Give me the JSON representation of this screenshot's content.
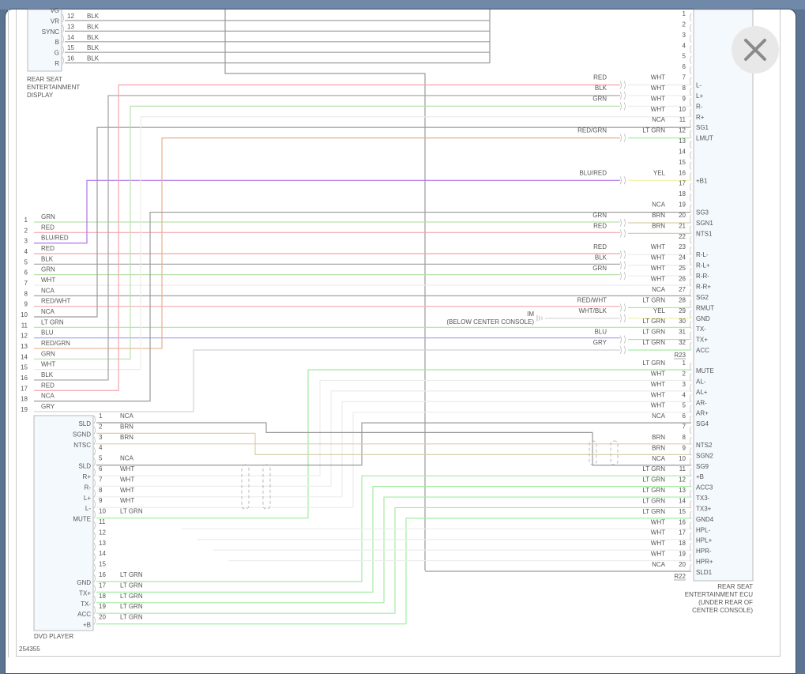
{
  "viewer": {
    "close_icon": "close-icon",
    "figure_id": "254355"
  },
  "wire_colors": {
    "RED": "#f4a3ad",
    "GRN": "#b9e0ac",
    "BLK": "#a0a0a0",
    "WHT": "#ececec",
    "NCA": "#9a9a9a",
    "LT GRN": "#a3eca3",
    "BRN": "#dccdb0",
    "YEL": "#f3f0a6",
    "BLU": "#a8a8f4",
    "RED/GRN": "#e6b08a",
    "BLU/RED": "#b273e8",
    "GRY": "#d2d2d2",
    "RED/WHT": "#f3b6b6",
    "WHT/BLK": "#d8d8d8"
  },
  "display": {
    "name_lines": [
      "REAR SEAT",
      "ENTERTAINMENT",
      "DISPLAY"
    ],
    "labels": [
      "VG",
      "VR",
      "SYNC",
      "B",
      "G",
      "R"
    ],
    "rows": [
      {
        "pin": "12",
        "color": "BLK"
      },
      {
        "pin": "13",
        "color": "BLK"
      },
      {
        "pin": "14",
        "color": "BLK"
      },
      {
        "pin": "15",
        "color": "BLK"
      },
      {
        "pin": "16",
        "color": "BLK"
      }
    ]
  },
  "left_connector": {
    "rows": [
      {
        "pin": "1",
        "color": "GRN"
      },
      {
        "pin": "2",
        "color": "RED"
      },
      {
        "pin": "3",
        "color": "BLU/RED"
      },
      {
        "pin": "4",
        "color": "RED"
      },
      {
        "pin": "5",
        "color": "BLK"
      },
      {
        "pin": "6",
        "color": "GRN"
      },
      {
        "pin": "7",
        "color": "WHT"
      },
      {
        "pin": "8",
        "color": "NCA"
      },
      {
        "pin": "9",
        "color": "RED/WHT"
      },
      {
        "pin": "10",
        "color": "NCA"
      },
      {
        "pin": "11",
        "color": "LT GRN"
      },
      {
        "pin": "12",
        "color": "BLU"
      },
      {
        "pin": "13",
        "color": "RED/GRN"
      },
      {
        "pin": "14",
        "color": "GRN"
      },
      {
        "pin": "15",
        "color": "WHT"
      },
      {
        "pin": "16",
        "color": "BLK"
      },
      {
        "pin": "17",
        "color": "RED"
      },
      {
        "pin": "18",
        "color": "NCA"
      },
      {
        "pin": "19",
        "color": "GRY"
      }
    ]
  },
  "ecu": {
    "name_lines": [
      "REAR SEAT",
      "ENTERTAINMENT ECU",
      "(UNDER REAR OF",
      "CENTER CONSOLE)"
    ],
    "r23": {
      "id": "R23",
      "rows": [
        {
          "pin": "1",
          "left": "",
          "right": "",
          "func": ""
        },
        {
          "pin": "2",
          "left": "",
          "right": "",
          "func": ""
        },
        {
          "pin": "3",
          "left": "",
          "right": "",
          "func": ""
        },
        {
          "pin": "4",
          "left": "",
          "right": "",
          "func": ""
        },
        {
          "pin": "5",
          "left": "",
          "right": "",
          "func": ""
        },
        {
          "pin": "6",
          "left": "",
          "right": "",
          "func": ""
        },
        {
          "pin": "7",
          "left": "RED",
          "right": "WHT",
          "func": "L-"
        },
        {
          "pin": "8",
          "left": "BLK",
          "right": "WHT",
          "func": "L+"
        },
        {
          "pin": "9",
          "left": "GRN",
          "right": "WHT",
          "func": "R-"
        },
        {
          "pin": "10",
          "left": "",
          "right": "WHT",
          "func": "R+"
        },
        {
          "pin": "11",
          "left": "",
          "right": "NCA",
          "func": "SG1"
        },
        {
          "pin": "12",
          "left": "RED/GRN",
          "right": "LT GRN",
          "func": "LMUT"
        },
        {
          "pin": "13",
          "left": "",
          "right": "",
          "func": ""
        },
        {
          "pin": "14",
          "left": "",
          "right": "",
          "func": ""
        },
        {
          "pin": "15",
          "left": "",
          "right": "",
          "func": ""
        },
        {
          "pin": "16",
          "left": "BLU/RED",
          "right": "YEL",
          "func": "+B1"
        },
        {
          "pin": "17",
          "left": "",
          "right": "",
          "func": ""
        },
        {
          "pin": "18",
          "left": "",
          "right": "",
          "func": ""
        },
        {
          "pin": "19",
          "left": "",
          "right": "NCA",
          "func": "SG3"
        },
        {
          "pin": "20",
          "left": "GRN",
          "right": "BRN",
          "func": "SGN1"
        },
        {
          "pin": "21",
          "left": "RED",
          "right": "BRN",
          "func": "NTS1"
        },
        {
          "pin": "22",
          "left": "",
          "right": "",
          "func": ""
        },
        {
          "pin": "23",
          "left": "RED",
          "right": "WHT",
          "func": "R-L-"
        },
        {
          "pin": "24",
          "left": "BLK",
          "right": "WHT",
          "func": "R-L+"
        },
        {
          "pin": "25",
          "left": "GRN",
          "right": "WHT",
          "func": "R-R-"
        },
        {
          "pin": "26",
          "left": "",
          "right": "WHT",
          "func": "R-R+"
        },
        {
          "pin": "27",
          "left": "",
          "right": "NCA",
          "func": "SG2"
        },
        {
          "pin": "28",
          "left": "RED/WHT",
          "right": "LT GRN",
          "func": "RMUT"
        },
        {
          "pin": "29",
          "left": "WHT/BLK",
          "right": "YEL",
          "func": "GND"
        },
        {
          "pin": "30",
          "left": "",
          "right": "LT GRN",
          "func": "TX-"
        },
        {
          "pin": "31",
          "left": "BLU",
          "right": "LT GRN",
          "func": "TX+"
        },
        {
          "pin": "32",
          "left": "GRY",
          "right": "LT GRN",
          "func": "ACC"
        }
      ]
    },
    "r22": {
      "id": "R22",
      "rows": [
        {
          "pin": "1",
          "color": "LT GRN",
          "func": "MUTE"
        },
        {
          "pin": "2",
          "color": "WHT",
          "func": "AL-"
        },
        {
          "pin": "3",
          "color": "WHT",
          "func": "AL+"
        },
        {
          "pin": "4",
          "color": "WHT",
          "func": "AR-"
        },
        {
          "pin": "5",
          "color": "WHT",
          "func": "AR+"
        },
        {
          "pin": "6",
          "color": "NCA",
          "func": "SG4"
        },
        {
          "pin": "7",
          "color": "",
          "func": ""
        },
        {
          "pin": "8",
          "color": "BRN",
          "func": "NTS2"
        },
        {
          "pin": "9",
          "color": "BRN",
          "func": "SGN2"
        },
        {
          "pin": "10",
          "color": "NCA",
          "func": "SG9"
        },
        {
          "pin": "11",
          "color": "LT GRN",
          "func": "+B"
        },
        {
          "pin": "12",
          "color": "LT GRN",
          "func": "ACC3"
        },
        {
          "pin": "13",
          "color": "LT GRN",
          "func": "TX3-"
        },
        {
          "pin": "14",
          "color": "LT GRN",
          "func": "TX3+"
        },
        {
          "pin": "15",
          "color": "LT GRN",
          "func": "GND4"
        },
        {
          "pin": "16",
          "color": "WHT",
          "func": "HPL-"
        },
        {
          "pin": "17",
          "color": "WHT",
          "func": "HPL+"
        },
        {
          "pin": "18",
          "color": "WHT",
          "func": "HPR-"
        },
        {
          "pin": "19",
          "color": "WHT",
          "func": "HPR+"
        },
        {
          "pin": "20",
          "color": "NCA",
          "func": "SLD1"
        }
      ]
    }
  },
  "ground": {
    "label": "IM",
    "location": "(BELOW CENTER CONSOLE)"
  },
  "dvd": {
    "name": "DVD PLAYER",
    "rows": [
      {
        "pin": "1",
        "color": "NCA",
        "func": "SLD"
      },
      {
        "pin": "2",
        "color": "BRN",
        "func": "SGND"
      },
      {
        "pin": "3",
        "color": "BRN",
        "func": "NTSC"
      },
      {
        "pin": "4",
        "color": "",
        "func": ""
      },
      {
        "pin": "5",
        "color": "NCA",
        "func": "SLD"
      },
      {
        "pin": "6",
        "color": "WHT",
        "func": "R+"
      },
      {
        "pin": "7",
        "color": "WHT",
        "func": "R-"
      },
      {
        "pin": "8",
        "color": "WHT",
        "func": "L+"
      },
      {
        "pin": "9",
        "color": "WHT",
        "func": "L-"
      },
      {
        "pin": "10",
        "color": "LT GRN",
        "func": "MUTE"
      },
      {
        "pin": "11",
        "color": "",
        "func": ""
      },
      {
        "pin": "12",
        "color": "",
        "func": ""
      },
      {
        "pin": "13",
        "color": "",
        "func": ""
      },
      {
        "pin": "14",
        "color": "",
        "func": ""
      },
      {
        "pin": "15",
        "color": "",
        "func": ""
      },
      {
        "pin": "16",
        "color": "LT GRN",
        "func": "GND"
      },
      {
        "pin": "17",
        "color": "LT GRN",
        "func": "TX+"
      },
      {
        "pin": "18",
        "color": "LT GRN",
        "func": "TX-"
      },
      {
        "pin": "19",
        "color": "LT GRN",
        "func": "ACC"
      },
      {
        "pin": "20",
        "color": "LT GRN",
        "func": "+B"
      }
    ]
  }
}
